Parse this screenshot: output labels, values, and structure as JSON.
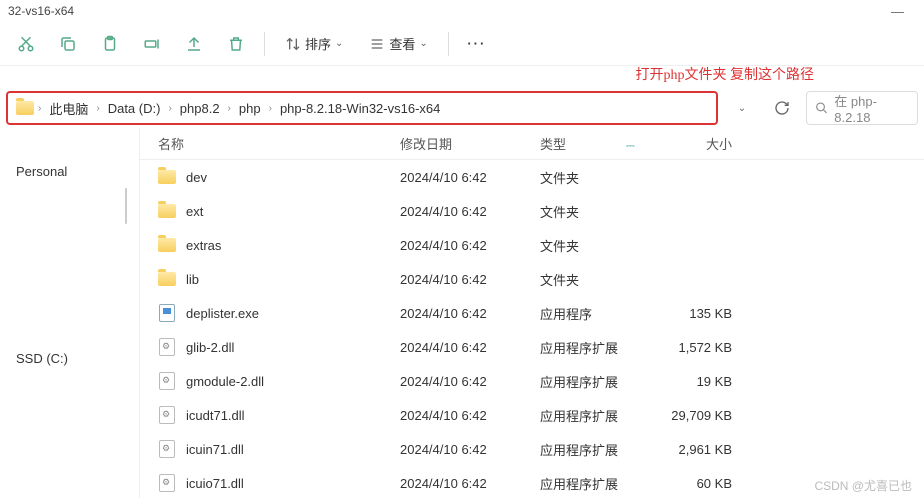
{
  "title": "32-vs16-x64",
  "annotation": "打开php文件夹 复制这个路径",
  "toolbar": {
    "sort": "排序",
    "view": "查看"
  },
  "breadcrumb": [
    "此电脑",
    "Data (D:)",
    "php8.2",
    "php",
    "php-8.2.18-Win32-vs16-x64"
  ],
  "search_placeholder": "在 php-8.2.18",
  "sidebar": {
    "personal": "Personal",
    "ssd": "SSD (C:)"
  },
  "columns": {
    "name": "名称",
    "date": "修改日期",
    "type": "类型",
    "size": "大小"
  },
  "rows": [
    {
      "icon": "folder",
      "name": "dev",
      "date": "2024/4/10 6:42",
      "type": "文件夹",
      "size": ""
    },
    {
      "icon": "folder",
      "name": "ext",
      "date": "2024/4/10 6:42",
      "type": "文件夹",
      "size": ""
    },
    {
      "icon": "folder",
      "name": "extras",
      "date": "2024/4/10 6:42",
      "type": "文件夹",
      "size": ""
    },
    {
      "icon": "folder",
      "name": "lib",
      "date": "2024/4/10 6:42",
      "type": "文件夹",
      "size": ""
    },
    {
      "icon": "exe",
      "name": "deplister.exe",
      "date": "2024/4/10 6:42",
      "type": "应用程序",
      "size": "135 KB"
    },
    {
      "icon": "dll",
      "name": "glib-2.dll",
      "date": "2024/4/10 6:42",
      "type": "应用程序扩展",
      "size": "1,572 KB"
    },
    {
      "icon": "dll",
      "name": "gmodule-2.dll",
      "date": "2024/4/10 6:42",
      "type": "应用程序扩展",
      "size": "19 KB"
    },
    {
      "icon": "dll",
      "name": "icudt71.dll",
      "date": "2024/4/10 6:42",
      "type": "应用程序扩展",
      "size": "29,709 KB"
    },
    {
      "icon": "dll",
      "name": "icuin71.dll",
      "date": "2024/4/10 6:42",
      "type": "应用程序扩展",
      "size": "2,961 KB"
    },
    {
      "icon": "dll",
      "name": "icuio71.dll",
      "date": "2024/4/10 6:42",
      "type": "应用程序扩展",
      "size": "60 KB"
    }
  ],
  "watermark": "CSDN @尤喜已也"
}
